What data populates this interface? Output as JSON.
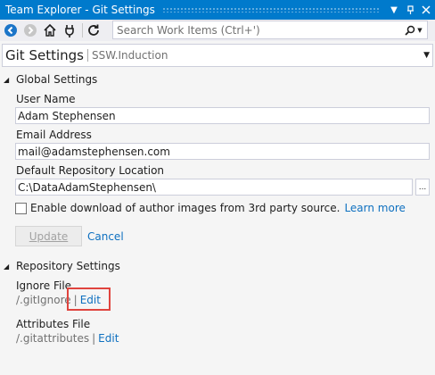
{
  "window": {
    "title": "Team Explorer - Git Settings",
    "pin_icon": "pin-icon",
    "close_icon": "close-icon"
  },
  "toolbar": {
    "back_icon": "back-arrow-icon",
    "forward_icon": "forward-arrow-icon",
    "home_icon": "home-icon",
    "connect_icon": "plug-icon",
    "refresh_icon": "refresh-icon",
    "search_placeholder": "Search Work Items (Ctrl+')"
  },
  "header": {
    "title": "Git Settings",
    "subtitle": "SSW.Induction"
  },
  "global_settings": {
    "section_label": "Global Settings",
    "user_name_label": "User Name",
    "user_name_value": "Adam Stephensen",
    "email_label": "Email Address",
    "email_value": "mail@adamstephensen.com",
    "repo_location_label": "Default Repository Location",
    "repo_location_value": "C:\\DataAdamStephensen\\",
    "browse_label": "...",
    "checkbox_label": "Enable download of author images from 3rd party source.",
    "learn_more_label": "Learn more",
    "update_label": "Update",
    "cancel_label": "Cancel"
  },
  "repository_settings": {
    "section_label": "Repository Settings",
    "ignore_file_label": "Ignore File",
    "ignore_file_name": "/.gitIgnore",
    "ignore_edit_label": "Edit",
    "attributes_file_label": "Attributes File",
    "attributes_file_name": "/.gitattributes",
    "attributes_edit_label": "Edit"
  },
  "colors": {
    "accent": "#007acc",
    "link": "#0e70c0",
    "highlight": "#e0443e"
  }
}
